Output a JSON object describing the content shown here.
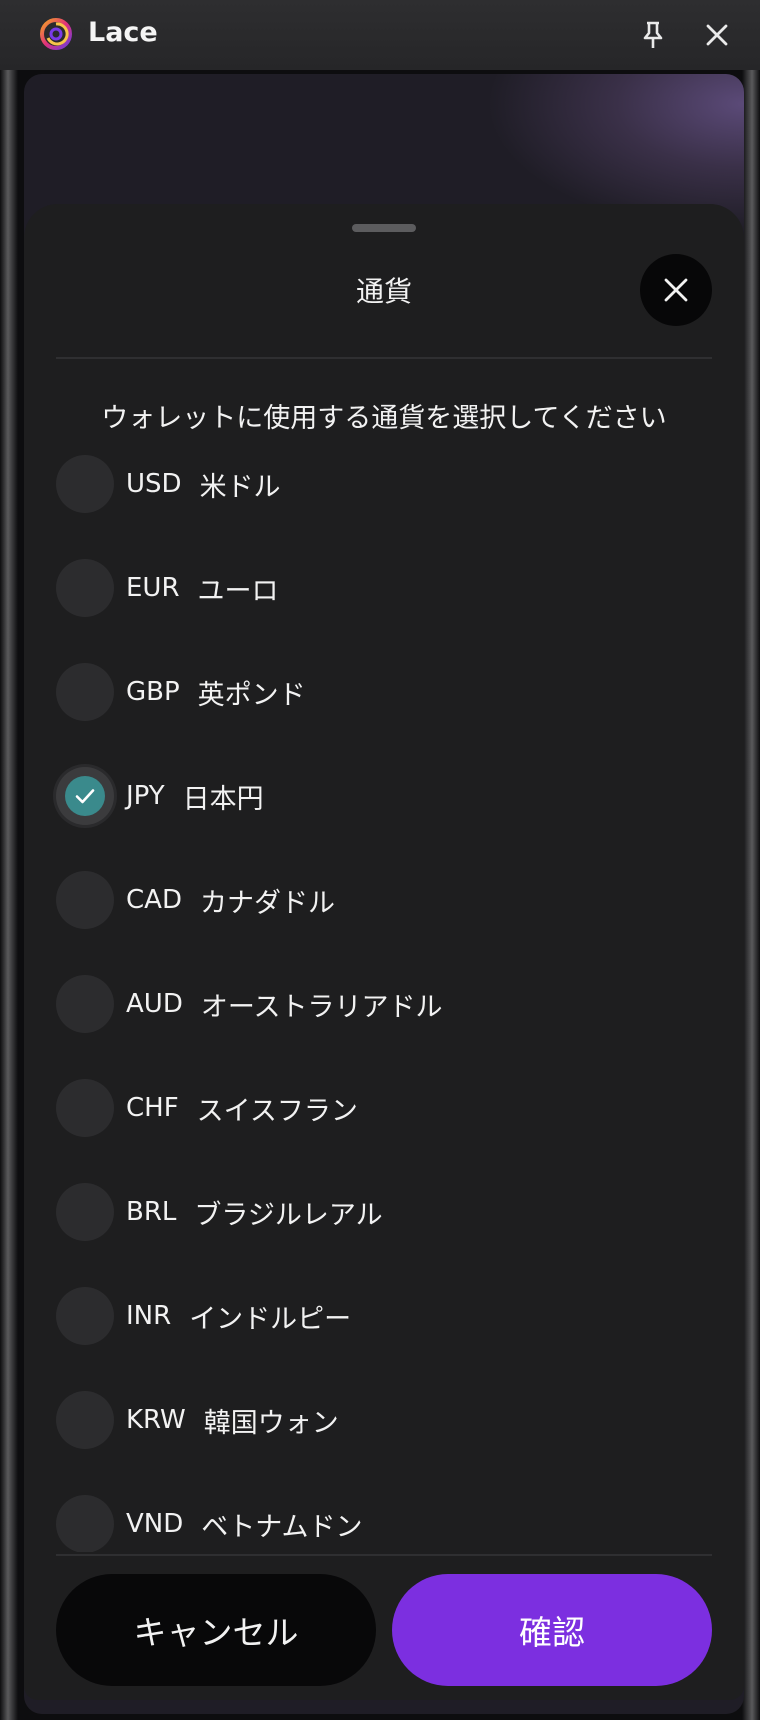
{
  "app": {
    "title": "Lace"
  },
  "titlebar": {
    "pin_icon": "pin-icon",
    "close_icon": "close-icon"
  },
  "sheet": {
    "title": "通貨",
    "subtitle": "ウォレットに使用する通貨を選択してください",
    "close_icon": "close-icon"
  },
  "currencies": [
    {
      "code": "USD",
      "name": "米ドル",
      "selected": false
    },
    {
      "code": "EUR",
      "name": "ユーロ",
      "selected": false
    },
    {
      "code": "GBP",
      "name": "英ポンド",
      "selected": false
    },
    {
      "code": "JPY",
      "name": "日本円",
      "selected": true
    },
    {
      "code": "CAD",
      "name": "カナダドル",
      "selected": false
    },
    {
      "code": "AUD",
      "name": "オーストラリアドル",
      "selected": false
    },
    {
      "code": "CHF",
      "name": "スイスフラン",
      "selected": false
    },
    {
      "code": "BRL",
      "name": "ブラジルレアル",
      "selected": false
    },
    {
      "code": "INR",
      "name": "インドルピー",
      "selected": false
    },
    {
      "code": "KRW",
      "name": "韓国ウォン",
      "selected": false
    },
    {
      "code": "VND",
      "name": "ベトナムドン",
      "selected": false
    }
  ],
  "buttons": {
    "cancel": "キャンセル",
    "confirm": "確認"
  },
  "colors": {
    "accent": "#7c2fe0",
    "selected_radio": "#3a8a8c"
  }
}
